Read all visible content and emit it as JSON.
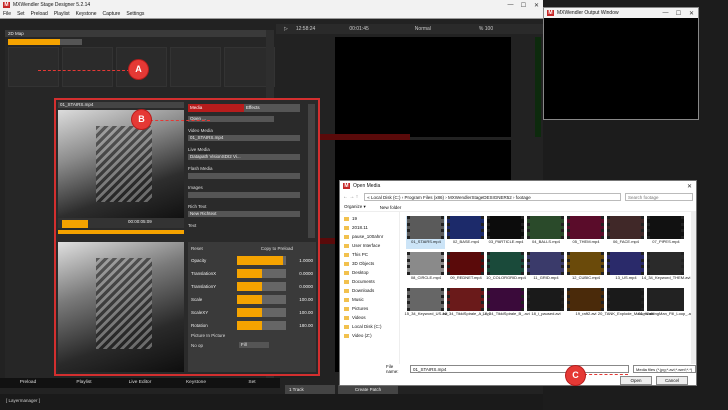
{
  "main_window": {
    "title": "MXWendler Stage Designer 5.2.14",
    "menu": [
      "File",
      "Set",
      "Preload",
      "Playlist",
      "Keystone",
      "Capture",
      "Settings"
    ],
    "controls": [
      "—",
      "☐",
      "✕"
    ]
  },
  "map": {
    "header": "2D Map"
  },
  "transport": {
    "time_left": "12:58:24",
    "time_pos": "00:01:45",
    "mode": "Normal",
    "percent": "% 100"
  },
  "callouts": {
    "a": "A",
    "b": "B",
    "c": "C"
  },
  "layer": {
    "clip_label": "01_STAIRS.mp4",
    "timecode": "00:00:05:09",
    "tabs": [
      "Media",
      "Effects"
    ],
    "open_btn": "Open ...",
    "video_media_label": "Video Media",
    "video_media_value": "01_STAIRS.mp4",
    "live_media_label": "Live Media",
    "live_media_value": "Datapath VisionSDI2 Vi...",
    "flash_media_label": "Flash Media",
    "images_label": "Images",
    "rich_text_label": "Rich Text",
    "rich_text_value": "New Richtext",
    "text_label": "Text",
    "reset_label": "Reset",
    "copy_preload": "Copy to Preload",
    "sliders": [
      {
        "name": "Opacity",
        "value": "1.0000",
        "level": 0.95
      },
      {
        "name": "TranslationX",
        "value": "0.0000",
        "level": 0.5
      },
      {
        "name": "TranslationY",
        "value": "0.0000",
        "level": 0.5
      },
      {
        "name": "Scale",
        "value": "100.00",
        "level": 0.5
      },
      {
        "name": "ScaleXY",
        "value": "100.00",
        "level": 0.5
      },
      {
        "name": "Rotation",
        "value": "180.00",
        "level": 0.5
      }
    ],
    "pip_label": "Picture In Picture",
    "no_op_label": "No op",
    "fill_label": "Fill"
  },
  "bottom_tabs": [
    "Preload",
    "Playlist",
    "Live Editor",
    "Keystone",
    "Set"
  ],
  "status_bar": "[ Layermanager ]",
  "bottom_right": {
    "track_btn": "1 Track",
    "create_patch": "Create Patch"
  },
  "output_window": {
    "title": "MXWendler Output Window"
  },
  "dialog": {
    "title": "Open Media",
    "breadcrumb": "« Local Disk (C:) › Program Files (x86) › MXWendlerStageDESIGNER52 › footage",
    "search_placeholder": "Search footage",
    "organize": "Organize ▾",
    "new_folder": "New folder",
    "nav": [
      "19",
      "2018.11",
      "pause_100ahnr",
      "User Interface",
      "This PC",
      "3D Objects",
      "Desktop",
      "Documents",
      "Downloads",
      "Music",
      "Pictures",
      "Videos",
      "Local Disk (C:)",
      "Video (Z:)"
    ],
    "files": [
      {
        "name": "01_STAIRS.mp4",
        "tone": "#5a5a5a"
      },
      {
        "name": "02_BASE.mp4",
        "tone": "#1c2a6a"
      },
      {
        "name": "03_PARTICLE.mp4",
        "tone": "#0c0c0c"
      },
      {
        "name": "04_BALLS.mp4",
        "tone": "#2a4a2a"
      },
      {
        "name": "05_THEM.mp4",
        "tone": "#5a0c2a"
      },
      {
        "name": "06_FACE.mp4",
        "tone": "#402828"
      },
      {
        "name": "07_PIPES.mp4",
        "tone": "#111111"
      },
      {
        "name": "08_CIRCLE.mp4",
        "tone": "#8a8a8a"
      },
      {
        "name": "09_REDNET.mp4",
        "tone": "#5a0a0a"
      },
      {
        "name": "10_COLORGRID.mp4",
        "tone": "#1a4a3a"
      },
      {
        "name": "11_GRID.mp4",
        "tone": "#3a3a6a"
      },
      {
        "name": "12_CUBIC.mp4",
        "tone": "#6a4a0a"
      },
      {
        "name": "13_US.mp4",
        "tone": "#2a2a6a"
      },
      {
        "name": "14_34_Keyword_THEM.avi",
        "tone": "#2a2a2a"
      },
      {
        "name": "15_34_Keyword_US.avi",
        "tone": "#666666"
      },
      {
        "name": "16_34_TikkiSpirale_A_.avi",
        "tone": "#6a1a1a"
      },
      {
        "name": "17_34_TikkiSpirale_B_.avi",
        "tone": "#3a0a3a"
      },
      {
        "name": "18_i_paused.avi",
        "tone": "#1a1a1a"
      },
      {
        "name": "19_raft2.avi",
        "tone": "#4a2a0a"
      },
      {
        "name": "20_TANK_Explode_Masked.avi",
        "tone": "#1a1a1a"
      },
      {
        "name": "21_WalkingMan_Fill_Loop_.avi",
        "tone": "#222222"
      }
    ],
    "filename_label": "File name:",
    "filename_value": "01_STAIRS.mp4",
    "filter_value": "Media files (*.jpg;*.avi;*.wmf;*.*)",
    "open_btn": "Open",
    "cancel_btn": "Cancel"
  }
}
